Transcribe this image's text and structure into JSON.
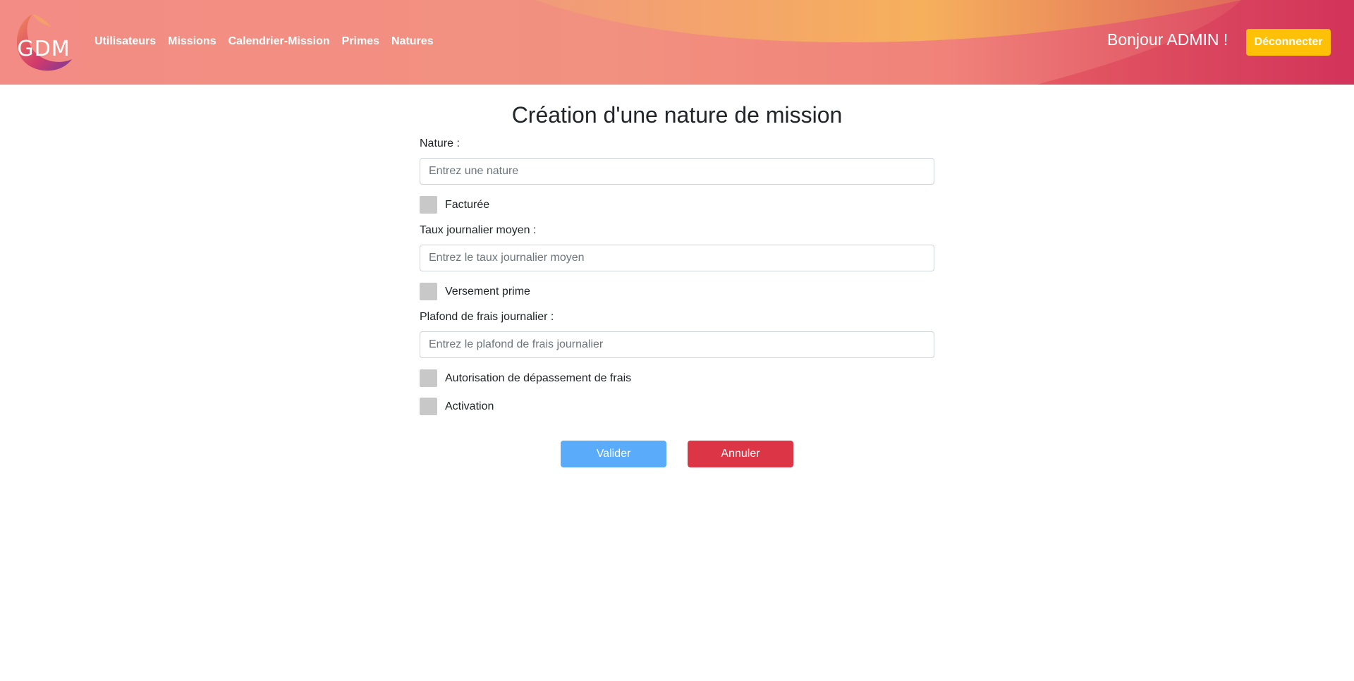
{
  "header": {
    "logo_text": "GDM",
    "nav": [
      "Utilisateurs",
      "Missions",
      "Calendrier-Mission",
      "Primes",
      "Natures"
    ],
    "greeting": "Bonjour ADMIN !",
    "logout_label": "Déconnecter"
  },
  "form": {
    "title": "Création d'une nature de mission",
    "nature_label": "Nature :",
    "nature_placeholder": "Entrez une nature",
    "facturee_label": "Facturée",
    "taux_label": "Taux journalier moyen :",
    "taux_placeholder": "Entrez le taux journalier moyen",
    "versement_label": "Versement prime",
    "plafond_label": "Plafond de frais journalier :",
    "plafond_placeholder": "Entrez le plafond de frais journalier",
    "autorisation_label": "Autorisation de dépassement de frais",
    "activation_label": "Activation",
    "submit_label": "Valider",
    "cancel_label": "Annuler"
  },
  "colors": {
    "header_start": "#f28c84",
    "header_end": "#d63a58",
    "logout_button": "#ffc107",
    "submit_button": "#5aabf9",
    "cancel_button": "#dc3545",
    "checkbox": "#c8c8c8"
  }
}
